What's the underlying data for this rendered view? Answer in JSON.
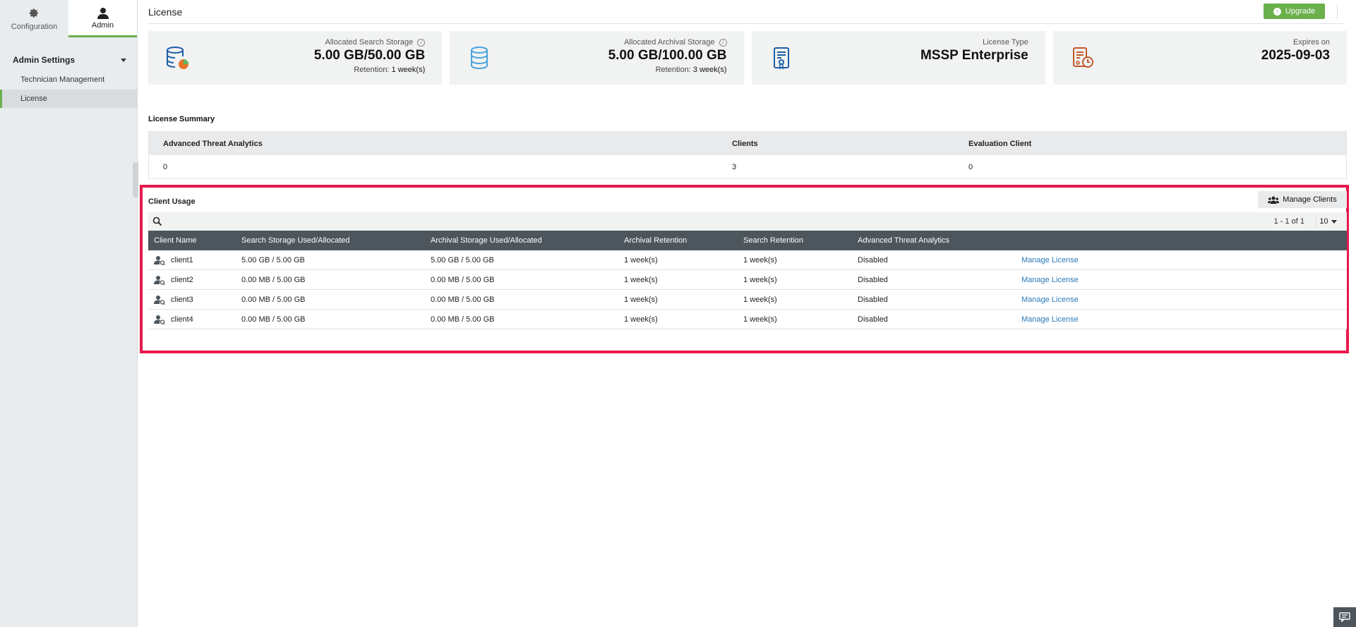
{
  "sidebar": {
    "tabs": [
      {
        "label": "Configuration",
        "icon": "gear-icon"
      },
      {
        "label": "Admin",
        "icon": "user-icon"
      }
    ],
    "section": "Admin Settings",
    "items": [
      {
        "label": "Technician Management"
      },
      {
        "label": "License"
      }
    ]
  },
  "header": {
    "title": "License",
    "upgrade_label": "Upgrade"
  },
  "cards": [
    {
      "label": "Allocated Search Storage",
      "value": "5.00 GB/50.00 GB",
      "sub_prefix": "Retention:",
      "sub_value": "1 week(s)",
      "icon": "database-chart-icon"
    },
    {
      "label": "Allocated Archival Storage",
      "value": "5.00 GB/100.00 GB",
      "sub_prefix": "Retention:",
      "sub_value": "3 week(s)",
      "icon": "database-icon"
    },
    {
      "label": "License Type",
      "value": "MSSP Enterprise",
      "icon": "license-document-icon"
    },
    {
      "label": "Expires on",
      "value": "2025-09-03",
      "icon": "expiry-clock-icon"
    }
  ],
  "summary": {
    "title": "License Summary",
    "headers": [
      "Advanced Threat Analytics",
      "Clients",
      "Evaluation Client"
    ],
    "values": [
      "0",
      "3",
      "0"
    ]
  },
  "usage": {
    "title": "Client Usage",
    "manage_clients_label": "Manage Clients",
    "pager_text": "1 - 1 of 1",
    "per_page": "10",
    "columns": [
      "Client Name",
      "Search Storage Used/Allocated",
      "Archival Storage Used/Allocated",
      "Archival Retention",
      "Search Retention",
      "Advanced Threat Analytics",
      ""
    ],
    "rows": [
      {
        "name": "client1",
        "search": "5.00 GB / 5.00 GB",
        "archival": "5.00 GB / 5.00 GB",
        "arch_ret": "1 week(s)",
        "search_ret": "1 week(s)",
        "ata": "Disabled",
        "action": "Manage License"
      },
      {
        "name": "client2",
        "search": "0.00 MB / 5.00 GB",
        "archival": "0.00 MB / 5.00 GB",
        "arch_ret": "1 week(s)",
        "search_ret": "1 week(s)",
        "ata": "Disabled",
        "action": "Manage License"
      },
      {
        "name": "client3",
        "search": "0.00 MB / 5.00 GB",
        "archival": "0.00 MB / 5.00 GB",
        "arch_ret": "1 week(s)",
        "search_ret": "1 week(s)",
        "ata": "Disabled",
        "action": "Manage License"
      },
      {
        "name": "client4",
        "search": "0.00 MB / 5.00 GB",
        "archival": "0.00 MB / 5.00 GB",
        "arch_ret": "1 week(s)",
        "search_ret": "1 week(s)",
        "ata": "Disabled",
        "action": "Manage License"
      }
    ]
  },
  "colors": {
    "accent_green": "#6ab04c",
    "highlight_red": "#e8194c",
    "grid_header": "#4c565c",
    "link_blue": "#2a7ab8"
  }
}
